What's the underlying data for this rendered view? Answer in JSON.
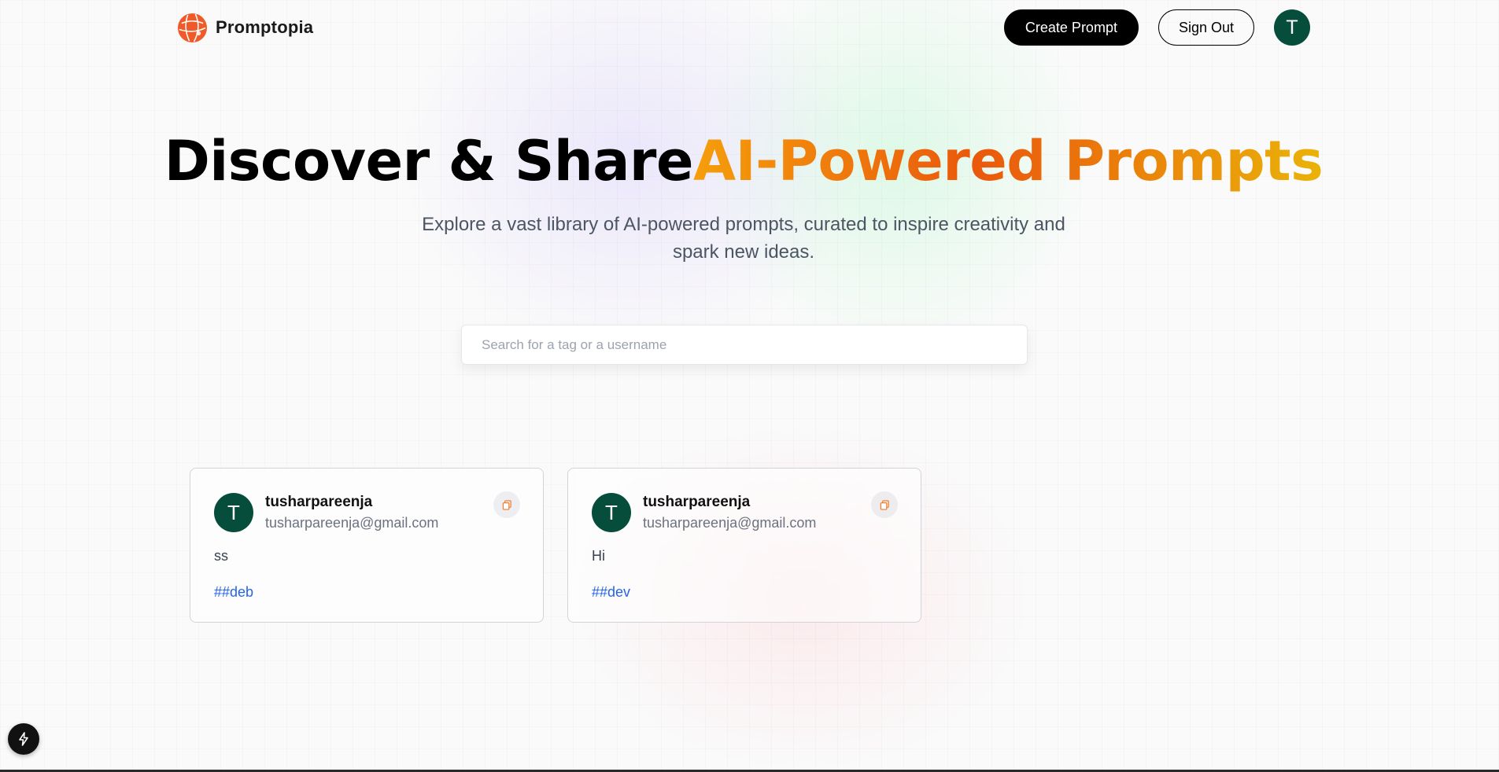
{
  "nav": {
    "brand": "Promptopia",
    "create_prompt": "Create Prompt",
    "sign_out": "Sign Out",
    "avatar_initial": "T"
  },
  "hero": {
    "title_plain": "Discover & Share",
    "title_gradient": "AI-Powered Prompts",
    "subtitle": "Explore a vast library of AI-powered prompts, curated to inspire creativity and spark new ideas."
  },
  "search": {
    "placeholder": "Search for a tag or a username",
    "value": ""
  },
  "prompts": [
    {
      "avatar_initial": "T",
      "username": "tusharpareenja",
      "email": "tusharpareenja@gmail.com",
      "prompt": "ss",
      "tag": "##deb"
    },
    {
      "avatar_initial": "T",
      "username": "tusharpareenja",
      "email": "tusharpareenja@gmail.com",
      "prompt": "Hi",
      "tag": "##dev"
    }
  ],
  "icons": {
    "logo": "globe-logo-icon",
    "copy": "copy-icon",
    "dev_indicator": "lightning-icon"
  },
  "colors": {
    "primary_button": "#000000",
    "avatar_bg": "#064e3b",
    "gradient_start": "#f59e0b",
    "gradient_mid": "#ea580c",
    "gradient_end": "#eab308",
    "tag": "#2563eb",
    "logo": "#f05a28"
  }
}
